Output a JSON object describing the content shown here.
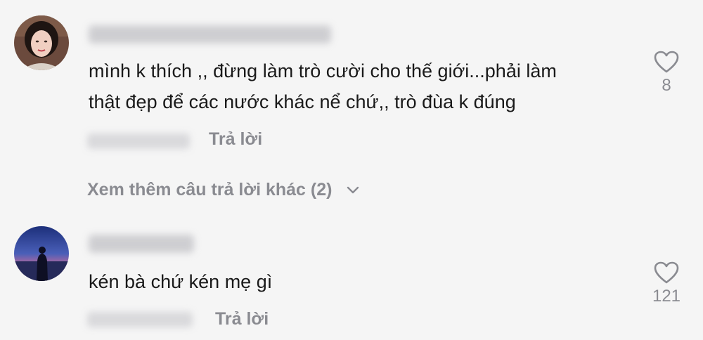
{
  "comments": [
    {
      "avatar_icon": "user-avatar-woman",
      "text_lines": [
        "mình k thích ,, đừng làm trò cười cho thế giới...phải làm",
        "thật đẹp để các nước khác nể chứ,, trò đùa k đúng"
      ],
      "reply_label": "Trả lời",
      "like_icon": "heart-outline-icon",
      "like_count": "8",
      "view_more_label": "Xem thêm câu trả lời khác (2)"
    },
    {
      "avatar_icon": "user-avatar-silhouette-sunset",
      "text_lines": [
        "kén bà chứ kén mẹ gì"
      ],
      "reply_label": "Trả lời",
      "like_icon": "heart-outline-icon",
      "like_count": "121"
    }
  ],
  "colors": {
    "background": "#f5f5f5",
    "text": "#1a1a1a",
    "muted": "#8a8b91"
  }
}
